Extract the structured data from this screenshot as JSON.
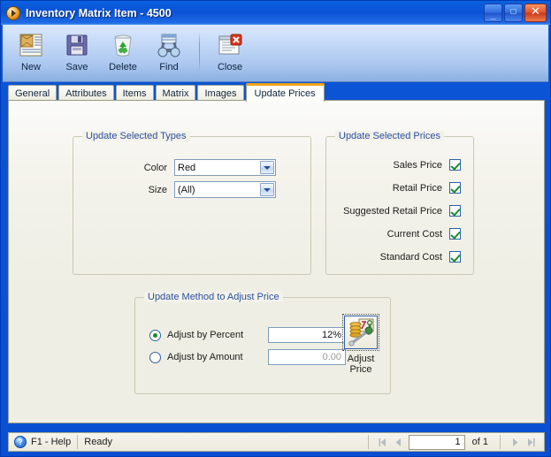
{
  "window": {
    "title": "Inventory Matrix Item - 4500",
    "app_icon": "orange-orb-icon",
    "controls": {
      "minimize": "_",
      "maximize": "□",
      "close": "✕"
    }
  },
  "toolbar": {
    "buttons": [
      {
        "label": "New",
        "icon": "new-document-icon"
      },
      {
        "label": "Save",
        "icon": "floppy-disk-icon"
      },
      {
        "label": "Delete",
        "icon": "recycle-bin-icon"
      },
      {
        "label": "Find",
        "icon": "binoculars-icon"
      },
      {
        "label": "Close",
        "icon": "close-window-icon"
      }
    ]
  },
  "tabs": [
    {
      "label": "General",
      "active": false
    },
    {
      "label": "Attributes",
      "active": false
    },
    {
      "label": "Items",
      "active": false
    },
    {
      "label": "Matrix",
      "active": false
    },
    {
      "label": "Images",
      "active": false
    },
    {
      "label": "Update Prices",
      "active": true
    }
  ],
  "update_selected_types": {
    "title": "Update Selected Types",
    "fields": [
      {
        "label": "Color",
        "value": "Red"
      },
      {
        "label": "Size",
        "value": "(All)"
      }
    ]
  },
  "update_selected_prices": {
    "title": "Update Selected Prices",
    "items": [
      {
        "label": "Sales Price",
        "checked": true
      },
      {
        "label": "Retail Price",
        "checked": true
      },
      {
        "label": "Suggested Retail Price",
        "checked": true
      },
      {
        "label": "Current Cost",
        "checked": true
      },
      {
        "label": "Standard Cost",
        "checked": true
      }
    ]
  },
  "update_method": {
    "title": "Update Method to Adjust Price",
    "options": [
      {
        "label": "Adjust by Percent",
        "selected": true,
        "value": "12%",
        "disabled": false
      },
      {
        "label": "Adjust by Amount",
        "selected": false,
        "value": "0.00",
        "disabled": true
      }
    ],
    "action_button": {
      "line1": "Adjust",
      "line2": "Price",
      "icon": "coins-calculator-wrench-icon"
    }
  },
  "statusbar": {
    "help_icon": "help-question-icon",
    "help_label": "F1 - Help",
    "status": "Ready",
    "nav": {
      "first": "first-record-icon",
      "previous": "previous-record-icon",
      "record": "1",
      "of_label": "of",
      "total": "1",
      "next": "next-record-icon",
      "last": "last-record-icon"
    }
  },
  "colors": {
    "title_blue": "#0a52d6",
    "accent_orange": "#f0a31c",
    "group_title_blue": "#2b4f9c",
    "check_green": "#1a8a2e",
    "panel_beige": "#eeeee4"
  }
}
